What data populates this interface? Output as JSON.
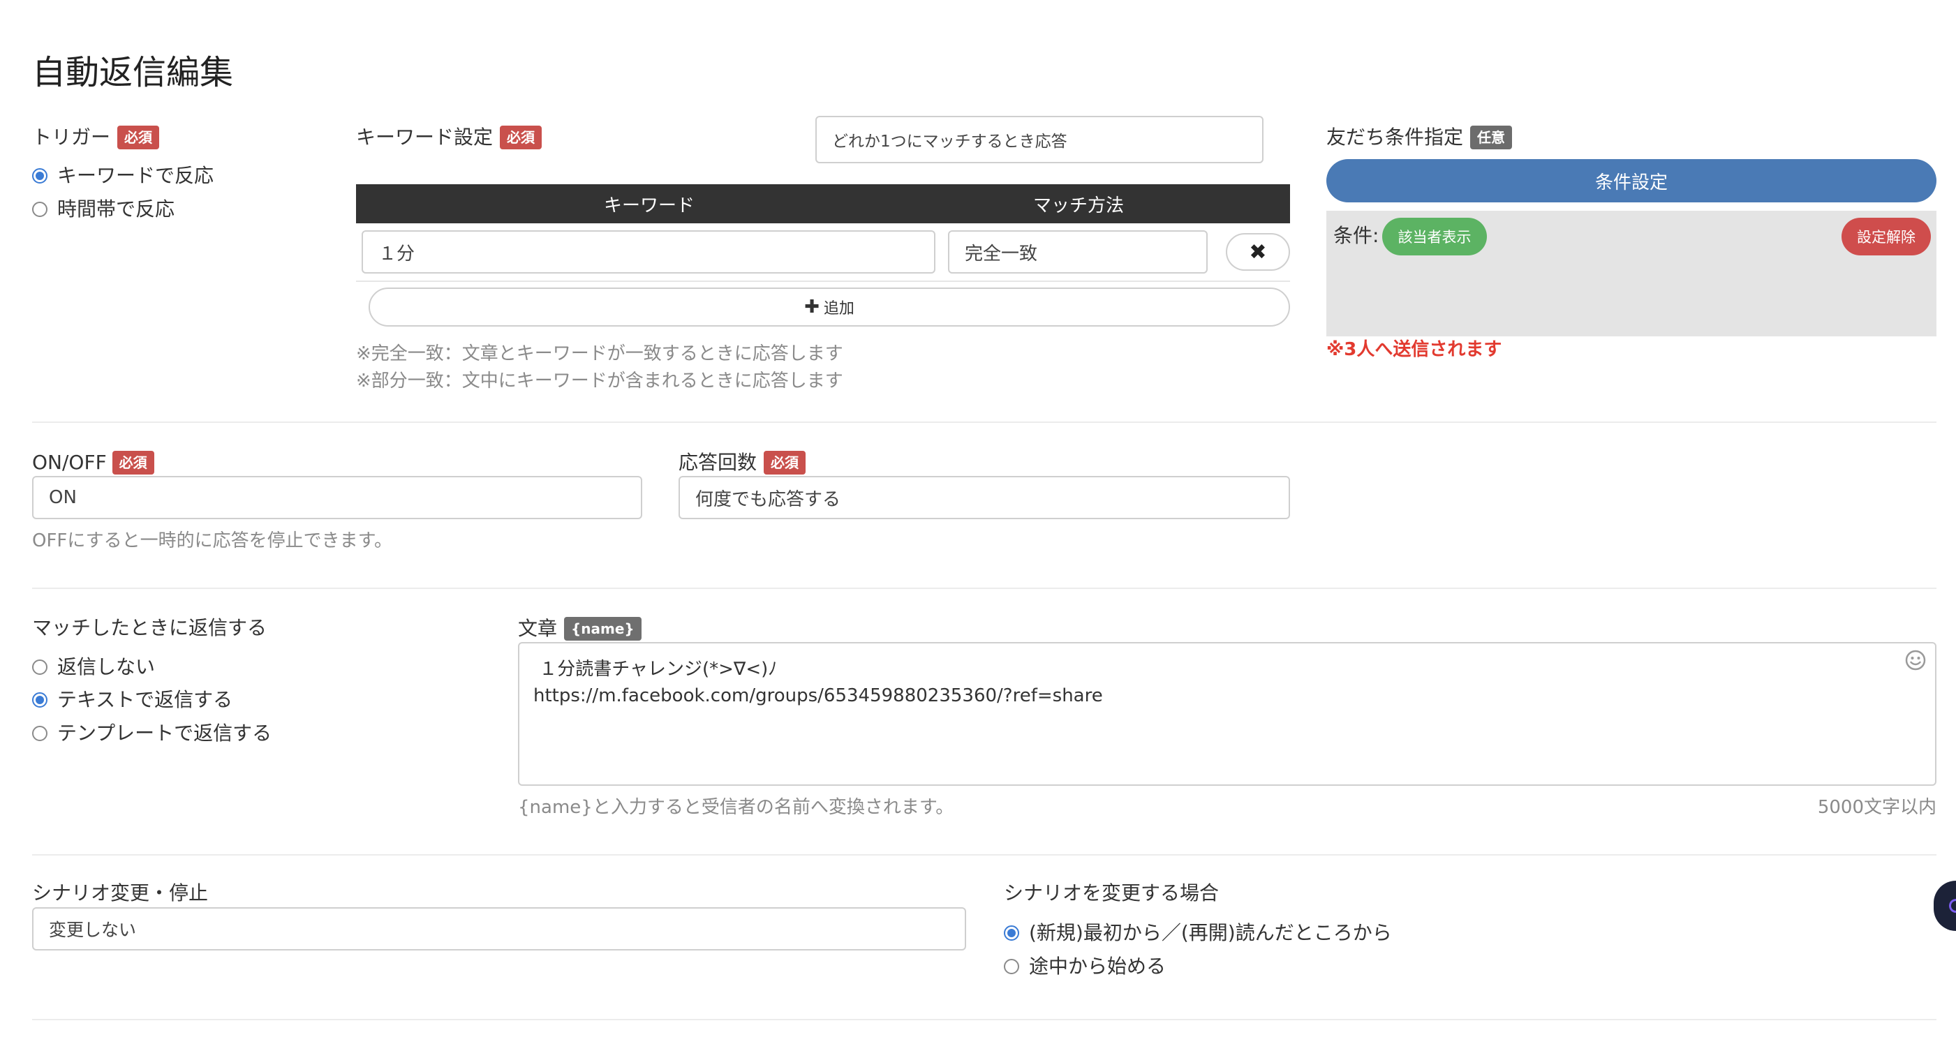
{
  "page": {
    "title": "自動返信編集"
  },
  "trigger": {
    "label": "トリガー",
    "badge": "必須",
    "options": [
      {
        "label": "キーワードで反応",
        "selected": true
      },
      {
        "label": "時間帯で反応",
        "selected": false
      }
    ]
  },
  "keyword_settings": {
    "label": "キーワード設定",
    "badge": "必須",
    "match_mode_value": "どれか1つにマッチするとき応答",
    "table": {
      "headers": [
        "キーワード",
        "マッチ方法"
      ],
      "rows": [
        {
          "keyword": "１分",
          "method": "完全一致"
        }
      ]
    },
    "add_label": "追加",
    "notes": [
      "※完全一致：文章とキーワードが一致するときに応答します",
      "※部分一致：文中にキーワードが含まれるときに応答します"
    ]
  },
  "friend_conditions": {
    "label": "友だち条件指定",
    "badge": "任意",
    "set_button": "条件設定",
    "conditions_label": "条件:",
    "show_matches_button": "該当者表示",
    "clear_button": "設定解除",
    "send_note": "※3人へ送信されます"
  },
  "onoff": {
    "label": "ON/OFF",
    "badge": "必須",
    "value": "ON",
    "hint": "OFFにすると一時的に応答を停止できます。"
  },
  "response_count": {
    "label": "応答回数",
    "badge": "必須",
    "value": "何度でも応答する"
  },
  "reply": {
    "label": "マッチしたときに返信する",
    "options": [
      {
        "label": "返信しない",
        "selected": false
      },
      {
        "label": "テキストで返信する",
        "selected": true
      },
      {
        "label": "テンプレートで返信する",
        "selected": false
      }
    ]
  },
  "message": {
    "label": "文章",
    "badge": "{name}",
    "text": " １分読書チャレンジ(*>∇<)ﾉ\nhttps://m.facebook.com/groups/653459880235360/?ref=share",
    "hint": "{name}と入力すると受信者の名前へ変換されます。",
    "limit": "5000文字以内",
    "emoji_icon": "smiley-icon"
  },
  "scenario": {
    "label": "シナリオ変更・停止",
    "value": "変更しない"
  },
  "scenario_change": {
    "label": "シナリオを変更する場合",
    "options": [
      {
        "label": "(新規)最初から／(再開)読んだところから",
        "selected": true
      },
      {
        "label": "途中から始める",
        "selected": false
      }
    ]
  },
  "colors": {
    "required_badge": "#c9504c",
    "optional_badge": "#6f6f6f",
    "primary_button": "#4a7ab5",
    "success_button": "#5cb363",
    "danger_button": "#cf4d4c",
    "warning_text": "#e23a2f",
    "table_header": "#333333"
  }
}
